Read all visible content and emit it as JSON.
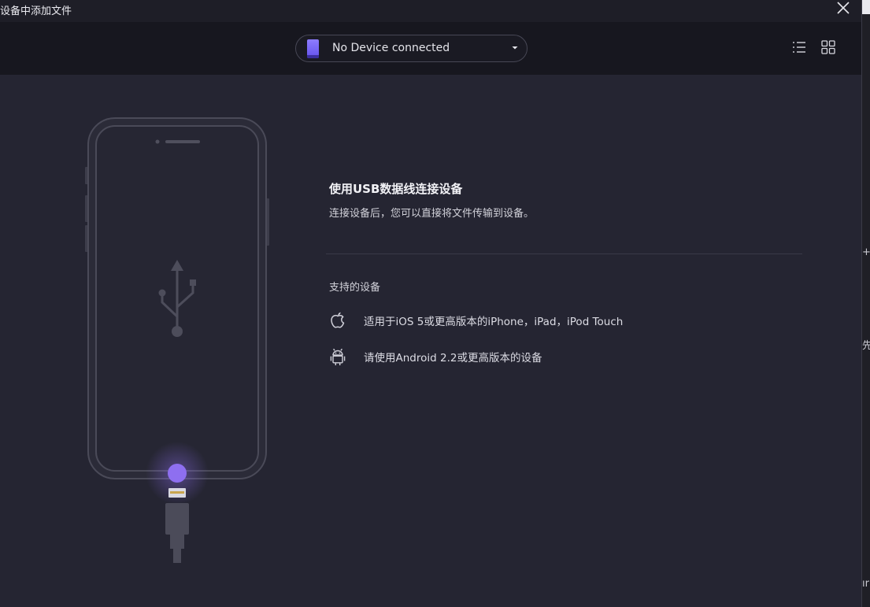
{
  "window": {
    "title": "设备中添加文件"
  },
  "toolbar": {
    "device_select": "No Device connected"
  },
  "main": {
    "heading": "使用USB数据线连接设备",
    "subtext": "连接设备后，您可以直接将文件传输到设备。",
    "support_title": "支持的设备",
    "devices": [
      {
        "icon": "apple-icon",
        "text": "适用于iOS 5或更高版本的iPhone，iPad，iPod Touch"
      },
      {
        "icon": "android-icon",
        "text": "请使用Android 2.2或更高版本的设备"
      }
    ]
  },
  "right_strip": {
    "text_1": "+",
    "text_2": "先",
    "text_3": "ır"
  },
  "colors": {
    "accent": "#8e6ff0",
    "background": "#252532",
    "toolbar": "#17171f"
  }
}
